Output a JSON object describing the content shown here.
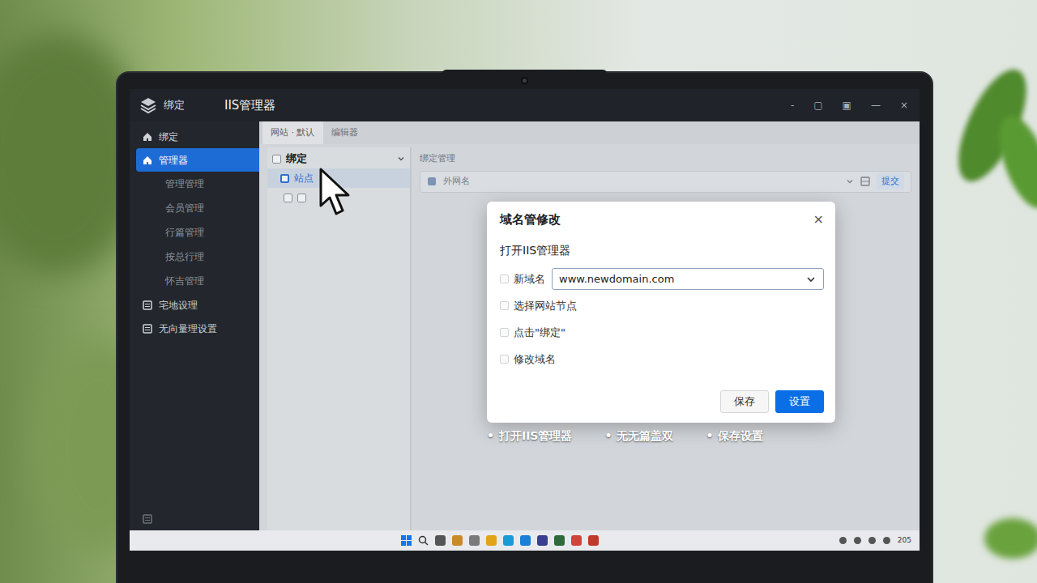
{
  "window": {
    "logo": "绑定",
    "title": "IIS管理器",
    "controls": [
      "-",
      "▢",
      "▣",
      "—",
      "×"
    ]
  },
  "sidebar": {
    "items": [
      {
        "label": "绑定",
        "kind": "top",
        "selected": false
      },
      {
        "label": "管理器",
        "kind": "top",
        "selected": true
      },
      {
        "label": "管理管理",
        "kind": "sub",
        "selected": false
      },
      {
        "label": "会员管理",
        "kind": "sub",
        "selected": false
      },
      {
        "label": "行篇管理",
        "kind": "sub",
        "selected": false
      },
      {
        "label": "按总行理",
        "kind": "sub",
        "selected": false
      },
      {
        "label": "怀吉管理",
        "kind": "sub",
        "selected": false
      },
      {
        "label": "宅地设理",
        "kind": "top",
        "selected": false
      },
      {
        "label": "无向量理设置",
        "kind": "top",
        "selected": false
      }
    ]
  },
  "tabs": [
    {
      "label": "网站 · 默认",
      "selected": true
    },
    {
      "label": "编辑器",
      "selected": false
    }
  ],
  "tree": {
    "header": "绑定",
    "checked": false,
    "expanded": true,
    "rows": [
      {
        "label": "站点",
        "kind": "single",
        "checks": [
          false
        ],
        "selected": true
      },
      {
        "kind": "pair",
        "checks": [
          false,
          false
        ],
        "selected": false
      }
    ]
  },
  "panel": {
    "label": "绑定管理",
    "placeholder": "外网名",
    "button": "提交"
  },
  "dialog": {
    "title": "域名管修改",
    "close": "×",
    "subtitle": "打开IIS管理器",
    "steps": [
      {
        "label": "新域名",
        "kind": "field",
        "value": "www.newdomain.com",
        "checked": false
      },
      {
        "label": "选择网站节点",
        "kind": "check",
        "checked": false
      },
      {
        "label": "点击\"绑定\"",
        "kind": "check",
        "checked": false
      },
      {
        "label": "修改域名",
        "kind": "check",
        "checked": false
      }
    ],
    "buttons": [
      {
        "label": "保存",
        "primary": false
      },
      {
        "label": "设置",
        "primary": true
      }
    ]
  },
  "captions": {
    "bullet": "•",
    "items": [
      "打开IIS管理器",
      "无无篇盖双",
      "保存设置"
    ]
  },
  "taskbar": {
    "tray": "205"
  }
}
